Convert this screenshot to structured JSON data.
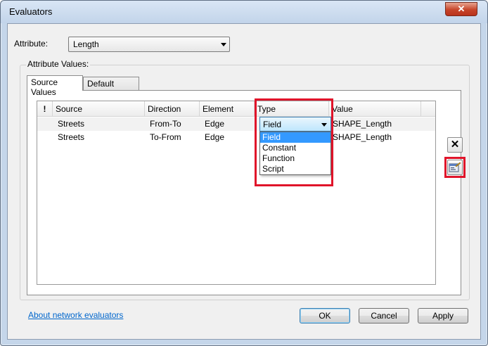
{
  "window": {
    "title": "Evaluators",
    "close_glyph": "✕"
  },
  "attribute": {
    "label": "Attribute:",
    "value": "Length"
  },
  "attribute_values": {
    "label": "Attribute Values:",
    "tabs": [
      {
        "label": "Source Values",
        "active": true
      },
      {
        "label": "Default Values",
        "active": false
      }
    ]
  },
  "grid": {
    "columns": [
      "!",
      "Source",
      "Direction",
      "Element",
      "Type",
      "Value"
    ],
    "rows": [
      {
        "source": "Streets",
        "direction": "From-To",
        "element": "Edge",
        "type": "Field",
        "value": "SHAPE_Length"
      },
      {
        "source": "Streets",
        "direction": "To-From",
        "element": "Edge",
        "type": "",
        "value": "SHAPE_Length"
      }
    ],
    "type_dropdown": {
      "selected": "Field",
      "options": [
        "Field",
        "Constant",
        "Function",
        "Script"
      ]
    }
  },
  "side_buttons": {
    "delete_glyph": "✕",
    "properties_icon": "properties-icon"
  },
  "footer": {
    "link": "About network evaluators",
    "ok": "OK",
    "cancel": "Cancel",
    "apply": "Apply"
  },
  "colors": {
    "highlight": "#e0142a",
    "selection": "#3399ff",
    "link": "#0066cc"
  }
}
